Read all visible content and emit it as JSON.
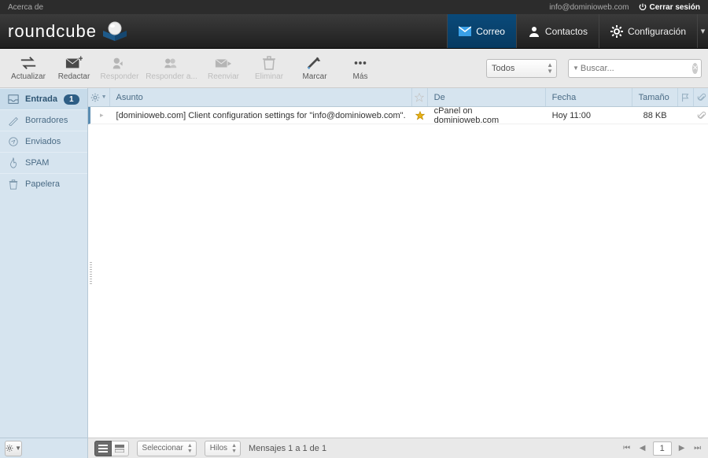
{
  "topbar": {
    "about": "Acerca de",
    "user_email": "info@dominioweb.com",
    "logout": "Cerrar sesión"
  },
  "brand": "roundcube",
  "tabs": {
    "mail": "Correo",
    "contacts": "Contactos",
    "settings": "Configuración"
  },
  "toolbar": {
    "refresh": "Actualizar",
    "compose": "Redactar",
    "reply": "Responder",
    "reply_all": "Responder a...",
    "forward": "Reenviar",
    "delete": "Eliminar",
    "mark": "Marcar",
    "more": "Más"
  },
  "filter": {
    "selected": "Todos"
  },
  "search": {
    "placeholder": "Buscar..."
  },
  "folders": [
    {
      "name": "Entrada",
      "badge": "1"
    },
    {
      "name": "Borradores"
    },
    {
      "name": "Enviados"
    },
    {
      "name": "SPAM"
    },
    {
      "name": "Papelera"
    }
  ],
  "columns": {
    "subject": "Asunto",
    "from": "De",
    "date": "Fecha",
    "size": "Tamaño"
  },
  "messages": [
    {
      "subject": "[dominioweb.com] Client configuration settings for \"info@dominioweb.com\".",
      "from": "cPanel on dominioweb.com",
      "date": "Hoy 11:00",
      "size": "88 KB",
      "starred": true,
      "attachment": true
    }
  ],
  "footer": {
    "select_label": "Seleccionar",
    "threads_label": "Hilos",
    "status": "Mensajes 1 a 1 de 1",
    "page": "1"
  }
}
